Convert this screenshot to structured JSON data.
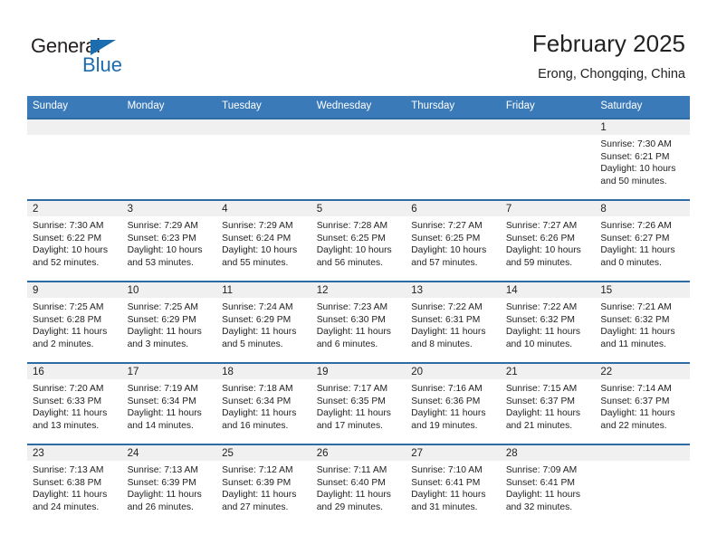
{
  "brand": {
    "name_top": "General",
    "name_bottom": "Blue",
    "triangle_color": "#1c6cb0",
    "text_color": "#231f20"
  },
  "header": {
    "title": "February 2025",
    "subtitle": "Erong, Chongqing, China"
  },
  "colors": {
    "header_row_bg": "#3b7ab8",
    "row_divider": "#2e6da4",
    "day_number_strip": "#f0f0f0",
    "text": "#222222"
  },
  "weekday_headers": [
    "Sunday",
    "Monday",
    "Tuesday",
    "Wednesday",
    "Thursday",
    "Friday",
    "Saturday"
  ],
  "weeks": [
    [
      {
        "day": "",
        "sunrise": "",
        "sunset": "",
        "daylight_1": "",
        "daylight_2": ""
      },
      {
        "day": "",
        "sunrise": "",
        "sunset": "",
        "daylight_1": "",
        "daylight_2": ""
      },
      {
        "day": "",
        "sunrise": "",
        "sunset": "",
        "daylight_1": "",
        "daylight_2": ""
      },
      {
        "day": "",
        "sunrise": "",
        "sunset": "",
        "daylight_1": "",
        "daylight_2": ""
      },
      {
        "day": "",
        "sunrise": "",
        "sunset": "",
        "daylight_1": "",
        "daylight_2": ""
      },
      {
        "day": "",
        "sunrise": "",
        "sunset": "",
        "daylight_1": "",
        "daylight_2": ""
      },
      {
        "day": "1",
        "sunrise": "Sunrise: 7:30 AM",
        "sunset": "Sunset: 6:21 PM",
        "daylight_1": "Daylight: 10 hours",
        "daylight_2": "and 50 minutes."
      }
    ],
    [
      {
        "day": "2",
        "sunrise": "Sunrise: 7:30 AM",
        "sunset": "Sunset: 6:22 PM",
        "daylight_1": "Daylight: 10 hours",
        "daylight_2": "and 52 minutes."
      },
      {
        "day": "3",
        "sunrise": "Sunrise: 7:29 AM",
        "sunset": "Sunset: 6:23 PM",
        "daylight_1": "Daylight: 10 hours",
        "daylight_2": "and 53 minutes."
      },
      {
        "day": "4",
        "sunrise": "Sunrise: 7:29 AM",
        "sunset": "Sunset: 6:24 PM",
        "daylight_1": "Daylight: 10 hours",
        "daylight_2": "and 55 minutes."
      },
      {
        "day": "5",
        "sunrise": "Sunrise: 7:28 AM",
        "sunset": "Sunset: 6:25 PM",
        "daylight_1": "Daylight: 10 hours",
        "daylight_2": "and 56 minutes."
      },
      {
        "day": "6",
        "sunrise": "Sunrise: 7:27 AM",
        "sunset": "Sunset: 6:25 PM",
        "daylight_1": "Daylight: 10 hours",
        "daylight_2": "and 57 minutes."
      },
      {
        "day": "7",
        "sunrise": "Sunrise: 7:27 AM",
        "sunset": "Sunset: 6:26 PM",
        "daylight_1": "Daylight: 10 hours",
        "daylight_2": "and 59 minutes."
      },
      {
        "day": "8",
        "sunrise": "Sunrise: 7:26 AM",
        "sunset": "Sunset: 6:27 PM",
        "daylight_1": "Daylight: 11 hours",
        "daylight_2": "and 0 minutes."
      }
    ],
    [
      {
        "day": "9",
        "sunrise": "Sunrise: 7:25 AM",
        "sunset": "Sunset: 6:28 PM",
        "daylight_1": "Daylight: 11 hours",
        "daylight_2": "and 2 minutes."
      },
      {
        "day": "10",
        "sunrise": "Sunrise: 7:25 AM",
        "sunset": "Sunset: 6:29 PM",
        "daylight_1": "Daylight: 11 hours",
        "daylight_2": "and 3 minutes."
      },
      {
        "day": "11",
        "sunrise": "Sunrise: 7:24 AM",
        "sunset": "Sunset: 6:29 PM",
        "daylight_1": "Daylight: 11 hours",
        "daylight_2": "and 5 minutes."
      },
      {
        "day": "12",
        "sunrise": "Sunrise: 7:23 AM",
        "sunset": "Sunset: 6:30 PM",
        "daylight_1": "Daylight: 11 hours",
        "daylight_2": "and 6 minutes."
      },
      {
        "day": "13",
        "sunrise": "Sunrise: 7:22 AM",
        "sunset": "Sunset: 6:31 PM",
        "daylight_1": "Daylight: 11 hours",
        "daylight_2": "and 8 minutes."
      },
      {
        "day": "14",
        "sunrise": "Sunrise: 7:22 AM",
        "sunset": "Sunset: 6:32 PM",
        "daylight_1": "Daylight: 11 hours",
        "daylight_2": "and 10 minutes."
      },
      {
        "day": "15",
        "sunrise": "Sunrise: 7:21 AM",
        "sunset": "Sunset: 6:32 PM",
        "daylight_1": "Daylight: 11 hours",
        "daylight_2": "and 11 minutes."
      }
    ],
    [
      {
        "day": "16",
        "sunrise": "Sunrise: 7:20 AM",
        "sunset": "Sunset: 6:33 PM",
        "daylight_1": "Daylight: 11 hours",
        "daylight_2": "and 13 minutes."
      },
      {
        "day": "17",
        "sunrise": "Sunrise: 7:19 AM",
        "sunset": "Sunset: 6:34 PM",
        "daylight_1": "Daylight: 11 hours",
        "daylight_2": "and 14 minutes."
      },
      {
        "day": "18",
        "sunrise": "Sunrise: 7:18 AM",
        "sunset": "Sunset: 6:34 PM",
        "daylight_1": "Daylight: 11 hours",
        "daylight_2": "and 16 minutes."
      },
      {
        "day": "19",
        "sunrise": "Sunrise: 7:17 AM",
        "sunset": "Sunset: 6:35 PM",
        "daylight_1": "Daylight: 11 hours",
        "daylight_2": "and 17 minutes."
      },
      {
        "day": "20",
        "sunrise": "Sunrise: 7:16 AM",
        "sunset": "Sunset: 6:36 PM",
        "daylight_1": "Daylight: 11 hours",
        "daylight_2": "and 19 minutes."
      },
      {
        "day": "21",
        "sunrise": "Sunrise: 7:15 AM",
        "sunset": "Sunset: 6:37 PM",
        "daylight_1": "Daylight: 11 hours",
        "daylight_2": "and 21 minutes."
      },
      {
        "day": "22",
        "sunrise": "Sunrise: 7:14 AM",
        "sunset": "Sunset: 6:37 PM",
        "daylight_1": "Daylight: 11 hours",
        "daylight_2": "and 22 minutes."
      }
    ],
    [
      {
        "day": "23",
        "sunrise": "Sunrise: 7:13 AM",
        "sunset": "Sunset: 6:38 PM",
        "daylight_1": "Daylight: 11 hours",
        "daylight_2": "and 24 minutes."
      },
      {
        "day": "24",
        "sunrise": "Sunrise: 7:13 AM",
        "sunset": "Sunset: 6:39 PM",
        "daylight_1": "Daylight: 11 hours",
        "daylight_2": "and 26 minutes."
      },
      {
        "day": "25",
        "sunrise": "Sunrise: 7:12 AM",
        "sunset": "Sunset: 6:39 PM",
        "daylight_1": "Daylight: 11 hours",
        "daylight_2": "and 27 minutes."
      },
      {
        "day": "26",
        "sunrise": "Sunrise: 7:11 AM",
        "sunset": "Sunset: 6:40 PM",
        "daylight_1": "Daylight: 11 hours",
        "daylight_2": "and 29 minutes."
      },
      {
        "day": "27",
        "sunrise": "Sunrise: 7:10 AM",
        "sunset": "Sunset: 6:41 PM",
        "daylight_1": "Daylight: 11 hours",
        "daylight_2": "and 31 minutes."
      },
      {
        "day": "28",
        "sunrise": "Sunrise: 7:09 AM",
        "sunset": "Sunset: 6:41 PM",
        "daylight_1": "Daylight: 11 hours",
        "daylight_2": "and 32 minutes."
      },
      {
        "day": "",
        "sunrise": "",
        "sunset": "",
        "daylight_1": "",
        "daylight_2": ""
      }
    ]
  ]
}
